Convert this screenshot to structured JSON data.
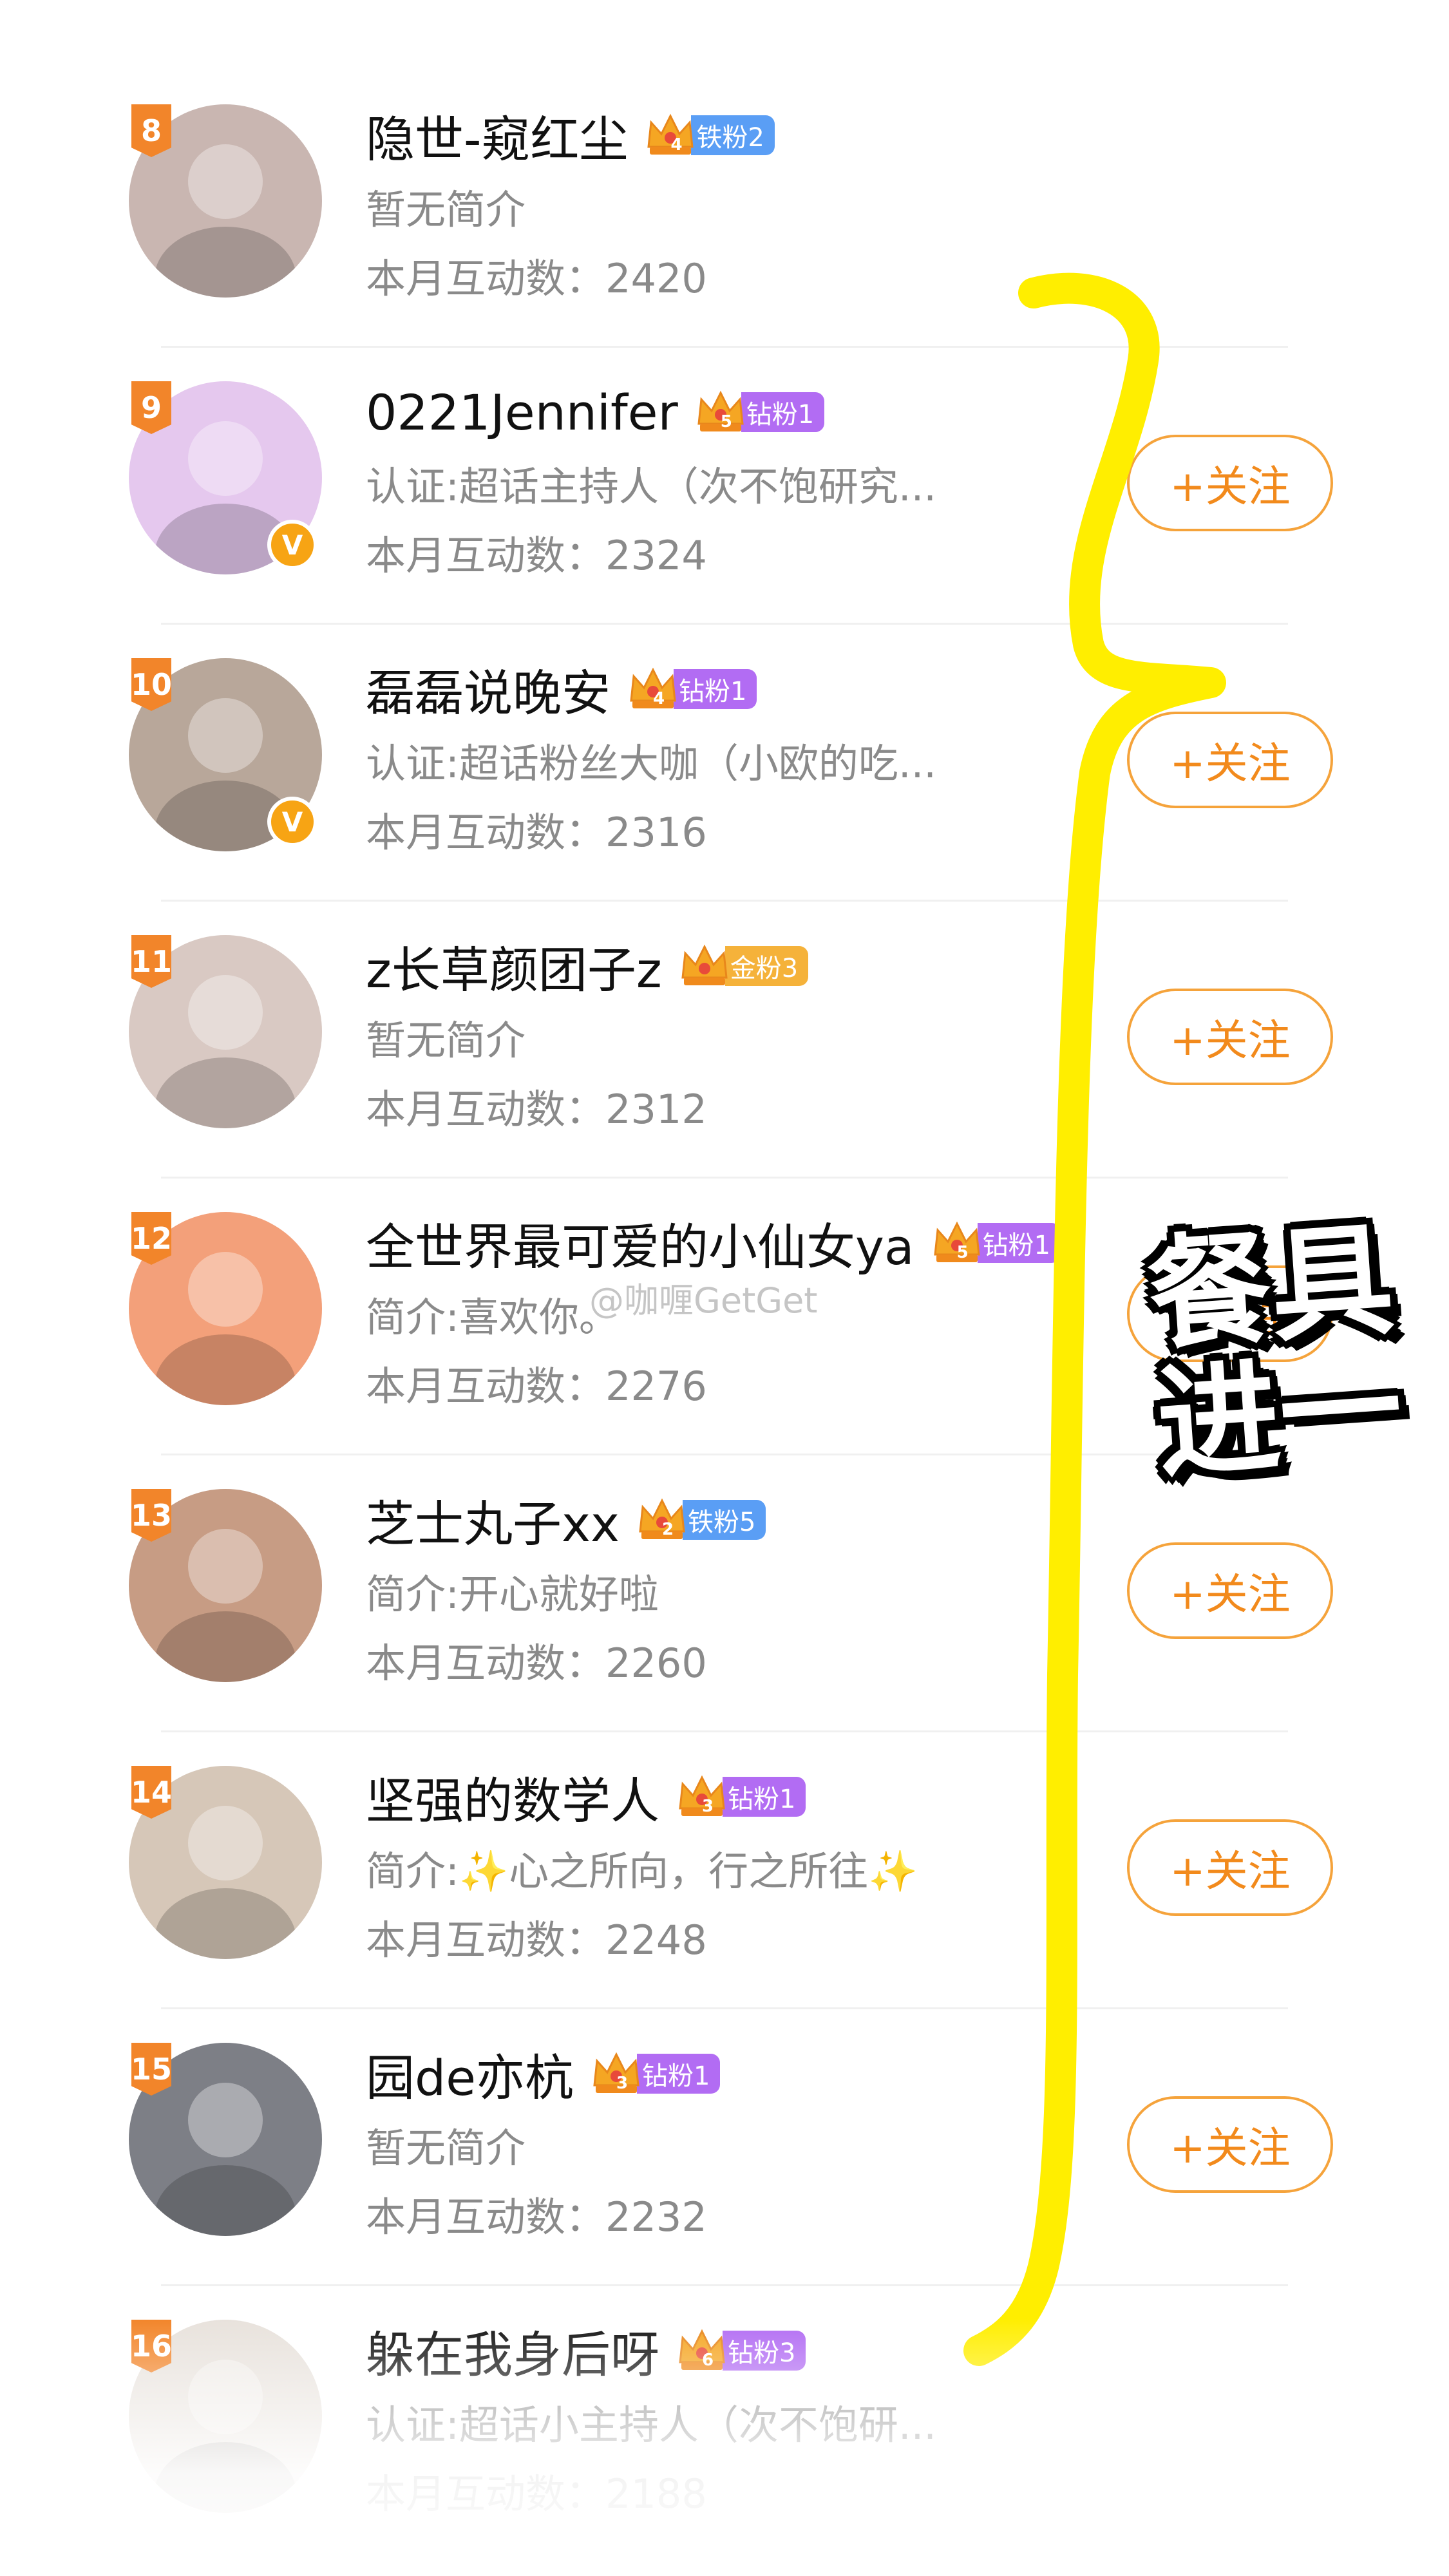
{
  "follow_label": "+关注",
  "count_label": "本月互动数：",
  "colors": {
    "accent": "#f28a1c",
    "highlighter": "#ffee00",
    "rank_badge": "#f2852a"
  },
  "rows": [
    {
      "rank": "8",
      "name": "隐世-窥红尘",
      "crown_level": "4",
      "badge_type": "iron",
      "badge": "铁粉2",
      "bio": "暂无简介",
      "count": "2420",
      "verified": false,
      "follow": false,
      "avatar_color": "#c9b6b1"
    },
    {
      "rank": "9",
      "name": "0221Jennifer",
      "crown_level": "5",
      "badge_type": "diamond",
      "badge": "钻粉1",
      "bio": "认证:超话主持人（次不饱研究...",
      "count": "2324",
      "verified": true,
      "follow": true,
      "avatar_color": "#e5c8ee"
    },
    {
      "rank": "10",
      "name": "磊磊说晚安",
      "crown_level": "4",
      "badge_type": "diamond",
      "badge": "钻粉1",
      "bio": "认证:超话粉丝大咖（小欧的吃...",
      "count": "2316",
      "verified": true,
      "follow": true,
      "avatar_color": "#b8a79a"
    },
    {
      "rank": "11",
      "name": "z长草颜团子z",
      "crown_level": "",
      "badge_type": "gold",
      "badge": "金粉3",
      "bio": "暂无简介",
      "count": "2312",
      "verified": false,
      "follow": true,
      "avatar_color": "#d9c9c3"
    },
    {
      "rank": "12",
      "name": "全世界最可爱的小仙女ya",
      "crown_level": "5",
      "badge_type": "diamond",
      "badge": "钻粉1",
      "bio": "简介:喜欢你。",
      "count": "2276",
      "verified": false,
      "follow": true,
      "avatar_color": "#f3a07a"
    },
    {
      "rank": "13",
      "name": "芝士丸子xx",
      "crown_level": "2",
      "badge_type": "iron",
      "badge": "铁粉5",
      "bio": "简介:开心就好啦",
      "count": "2260",
      "verified": false,
      "follow": true,
      "avatar_color": "#c79c84"
    },
    {
      "rank": "14",
      "name": "坚强的数学人",
      "crown_level": "3",
      "badge_type": "diamond",
      "badge": "钻粉1",
      "bio": "简介:✨心之所向，行之所往✨",
      "count": "2248",
      "verified": false,
      "follow": true,
      "avatar_color": "#d6c7b8"
    },
    {
      "rank": "15",
      "name": "园de亦杭",
      "crown_level": "3",
      "badge_type": "diamond",
      "badge": "钻粉1",
      "bio": "暂无简介",
      "count": "2232",
      "verified": false,
      "follow": true,
      "avatar_color": "#7d7f86"
    },
    {
      "rank": "16",
      "name": "躲在我身后呀",
      "crown_level": "6",
      "badge_type": "diamond",
      "badge": "钻粉3",
      "bio": "认证:超话小主持人（次不饱研...",
      "count": "2188",
      "verified": false,
      "follow": false,
      "avatar_color": "#e8e2dc"
    }
  ],
  "annotation_text": [
    "餐具",
    "进一"
  ],
  "watermark": "@咖喱GetGet"
}
